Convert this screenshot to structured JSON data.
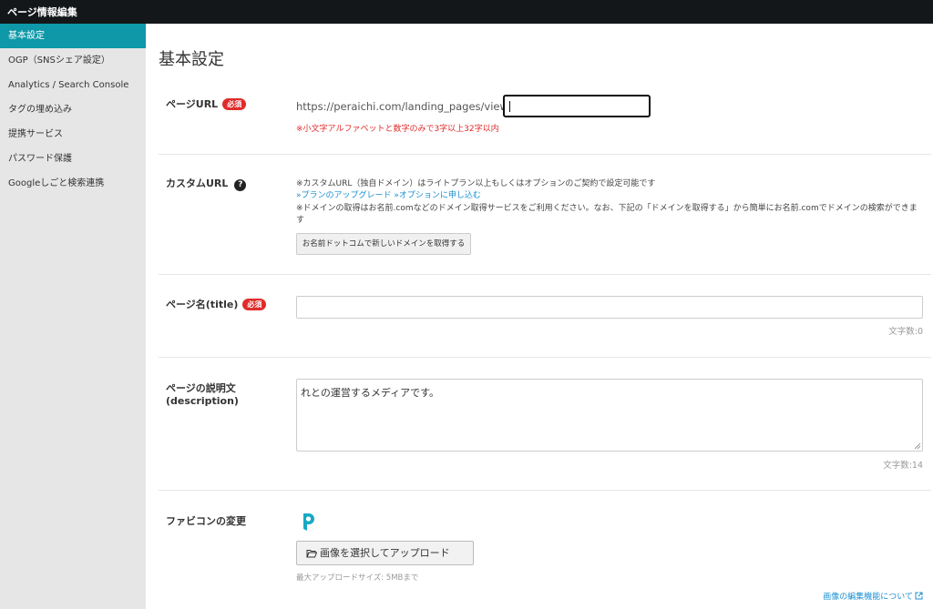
{
  "topbar": {
    "title": "ページ情報編集"
  },
  "sidebar": {
    "items": [
      {
        "label": "基本設定",
        "active": true
      },
      {
        "label": "OGP（SNSシェア設定）"
      },
      {
        "label": "Analytics / Search Console"
      },
      {
        "label": "タグの埋め込み"
      },
      {
        "label": "提携サービス"
      },
      {
        "label": "パスワード保護"
      },
      {
        "label": "Googleしごと検索連携"
      }
    ]
  },
  "main": {
    "title": "基本設定",
    "required_badge": "必須",
    "page_url": {
      "label": "ページURL",
      "prefix": "https://peraichi.com/landing_pages/view/",
      "value": "",
      "note": "※小文字アルファベットと数字のみで3字以上32字以内"
    },
    "custom_url": {
      "label": "カスタムURL",
      "help_icon": "question-circle-icon",
      "note1": "※カスタムURL（独自ドメイン）はライトプラン以上もしくはオプションのご契約で設定可能です",
      "link_upgrade": "»プランのアップグレード",
      "link_option": "»オプションに申し込む",
      "note2a": "※ドメインの取得はお名前.comなどのドメイン取得サービスをご利用ください。なお、下記の「ドメインを取得する」から簡単にお名前.comでドメインの検索ができま",
      "note2b": "す",
      "domain_button": "お名前ドットコムで新しいドメインを取得する"
    },
    "page_name": {
      "label": "ページ名(title)",
      "value": "",
      "counter": "文字数:0"
    },
    "description": {
      "label_line1": "ページの説明文",
      "label_line2": "(description)",
      "value": "れとの運営するメディアです。",
      "counter": "文字数:14"
    },
    "favicon": {
      "label": "ファビコンの変更",
      "icon": "peraichi-p-logo",
      "upload_button": "画像を選択してアップロード",
      "upload_icon": "folder-open-icon",
      "max_size_note": "最大アップロードサイズ: 5MBまで",
      "edit_link": "画像の編集機能について",
      "external_icon": "external-link-icon"
    }
  },
  "colors": {
    "accent": "#0e98a8",
    "required": "#e02b2b",
    "link": "#1a8fd0",
    "topbar": "#14171a"
  }
}
